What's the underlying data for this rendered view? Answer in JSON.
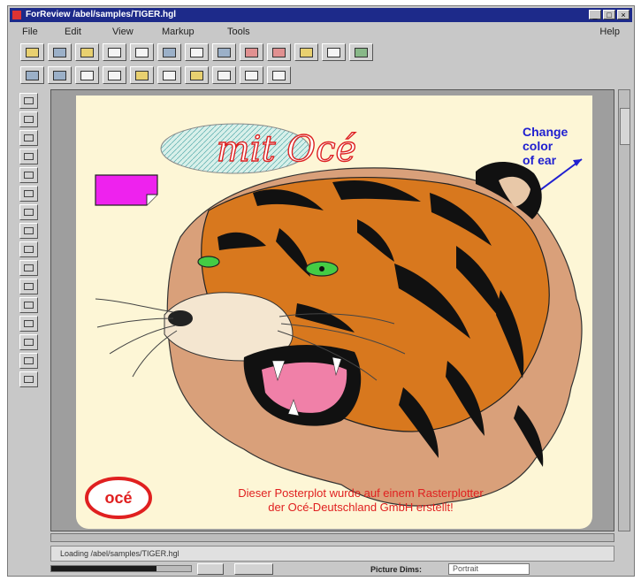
{
  "window": {
    "title": "ForReview /abel/samples/TIGER.hgl"
  },
  "menu": {
    "file": "File",
    "edit": "Edit",
    "view": "View",
    "markup": "Markup",
    "tools": "Tools",
    "help": "Help"
  },
  "document": {
    "heading": "mit Océ",
    "annotation": "Change color of ear",
    "annotation_lines": [
      "Change",
      "color",
      "of ear"
    ],
    "logo": "océ",
    "footer_line1": "Dieser Posterplot wurde auf einem Rasterplotter",
    "footer_line2": "der Océ-Deutschland GmbH erstellt!"
  },
  "status": {
    "message": "Loading /abel/samples/TIGER.hgl",
    "progress": 0.75,
    "picture_label": "Picture Dims:",
    "picture_value": "Portrait"
  },
  "colors": {
    "title_bar": "#1d2a8a",
    "annotation": "#2020d0",
    "footer_text": "#e02020",
    "markup_note": "#ee22ee",
    "page": "#fdf6d6"
  }
}
